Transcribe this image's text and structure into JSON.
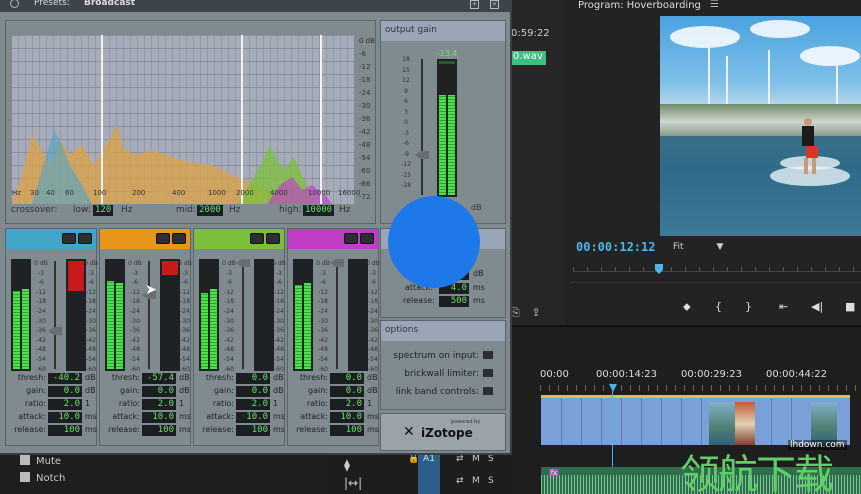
{
  "plugin": {
    "presets_label": "Presets:",
    "preset_value": "Broadcast",
    "spectrum": {
      "db_ticks": [
        "0 dB",
        "-6",
        "-12",
        "-18",
        "-24",
        "-30",
        "-36",
        "-42",
        "-48",
        "-54",
        "-60",
        "-66",
        "-72"
      ],
      "hz_ticks": [
        "Hz",
        "30",
        "40",
        "60",
        "100",
        "200",
        "400",
        "1000",
        "2000",
        "4000",
        "10000",
        "16000"
      ],
      "crossover_label": "crossover:",
      "low_label": "low:",
      "low_value": "120",
      "mid_label": "mid:",
      "mid_value": "2000",
      "high_label": "high:",
      "high_value": "10000",
      "unit": "Hz"
    },
    "output_gain": {
      "title": "output gain",
      "readout": "-13.4",
      "scale": [
        "18",
        "15",
        "12",
        "9",
        "6",
        "3",
        "0",
        "-3",
        "-6",
        "-9",
        "-12",
        "-15",
        "-18"
      ],
      "unit": "dB"
    },
    "bands": [
      {
        "color": "#3fa6c8",
        "thresh": "-40.2",
        "gain": "0.0",
        "ratio": "2.0",
        "attack": "10.0",
        "release": "100"
      },
      {
        "color": "#e8951c",
        "thresh": "-57.4",
        "gain": "0.0",
        "ratio": "2.0",
        "attack": "10.0",
        "release": "100"
      },
      {
        "color": "#7cc03a",
        "thresh": "0.0",
        "gain": "0.0",
        "ratio": "2.0",
        "attack": "10.0",
        "release": "100"
      },
      {
        "color": "#c13fc6",
        "thresh": "0.0",
        "gain": "0.0",
        "ratio": "2.0",
        "attack": "10.0",
        "release": "100"
      }
    ],
    "band_labels": {
      "thresh": "thresh:",
      "gain": "gain:",
      "ratio": "ratio:",
      "attack": "attack:",
      "release": "release:"
    },
    "band_units": {
      "thresh": "dB",
      "gain": "dB",
      "ratio": "1",
      "attack": "ms",
      "release": "ms"
    },
    "meter_scale": [
      "0 dB",
      "-3",
      "-6",
      "-12",
      "-18",
      "-24",
      "-30",
      "-36",
      "-42",
      "-48",
      "-54",
      "-60"
    ],
    "limiter": {
      "row1_unit": "dB",
      "attack_label": "attack:",
      "attack_value": "4.0",
      "attack_unit": "ms",
      "release_label": "release:",
      "release_value": "500",
      "release_unit": "ms"
    },
    "options": {
      "title": "options",
      "spectrum_on_input": "spectrum on input:",
      "brickwall_limiter": "brickwall limiter:",
      "link_band_controls": "link band controls:"
    },
    "logo": {
      "powered_by": "powered by",
      "name": "iZotope"
    }
  },
  "program": {
    "title": "Program: Hoverboarding",
    "menu_icon": "hamburger-icon",
    "timecode": "00:00:12:12",
    "fit_label": "Fit"
  },
  "source": {
    "timecode": "0:59:22",
    "clip_name": "0.wav"
  },
  "timeline": {
    "ruler": [
      "00:00",
      "00:00:14:23",
      "00:00:29:23",
      "00:00:44:22"
    ],
    "track_label": "A1",
    "m_label": "M",
    "s_label": "S"
  },
  "effects_list": {
    "items": [
      "Mute",
      "Notch"
    ]
  },
  "watermark": {
    "chinese": "领航下载",
    "url": "lhdown.com"
  }
}
